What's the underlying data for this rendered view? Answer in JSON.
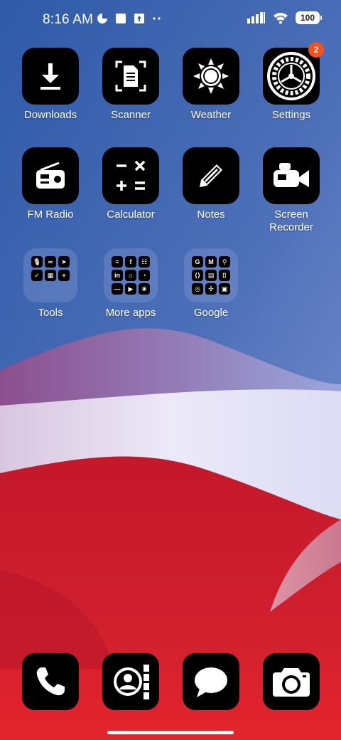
{
  "status_bar": {
    "time": "8:16 AM",
    "battery": "100",
    "icons": [
      "data-saver-icon",
      "square-notification-icon",
      "upload-notification-icon",
      "more-dots-icon",
      "signal-icon",
      "wifi-icon",
      "battery-icon"
    ]
  },
  "apps": [
    {
      "label": "Downloads",
      "icon": "download-icon"
    },
    {
      "label": "Scanner",
      "icon": "document-scan-icon"
    },
    {
      "label": "Weather",
      "icon": "sun-icon"
    },
    {
      "label": "Settings",
      "icon": "gear-icon",
      "badge": "2"
    },
    {
      "label": "FM Radio",
      "icon": "radio-icon"
    },
    {
      "label": "Calculator",
      "icon": "calculator-icon"
    },
    {
      "label": "Notes",
      "icon": "pencil-icon"
    },
    {
      "label": "Screen\nRecorder",
      "icon": "video-camera-icon"
    }
  ],
  "folders": [
    {
      "label": "Tools",
      "icons": [
        "🎙",
        "∞",
        "➤",
        "✓",
        "▦",
        "+"
      ]
    },
    {
      "label": "More apps",
      "icons": [
        "≡",
        "f",
        "☷",
        "in",
        "⌂",
        "◔",
        "—",
        "▶",
        "❀"
      ]
    },
    {
      "label": "Google",
      "icons": [
        "G",
        "M",
        "⚲",
        "⟨⟩",
        "▤",
        "⌷",
        "◎",
        "✣",
        "▣"
      ]
    }
  ],
  "dock": [
    {
      "name": "phone",
      "icon": "phone-icon"
    },
    {
      "name": "contacts",
      "icon": "contacts-icon"
    },
    {
      "name": "messages",
      "icon": "message-bubble-icon"
    },
    {
      "name": "camera",
      "icon": "camera-icon"
    }
  ],
  "colors": {
    "wallpaper_top": "#2b57a5",
    "wallpaper_mid": "#e8e6f7",
    "wallpaper_bottom": "#d31a2a",
    "badge": "#f4511e",
    "tile": "#000000"
  }
}
